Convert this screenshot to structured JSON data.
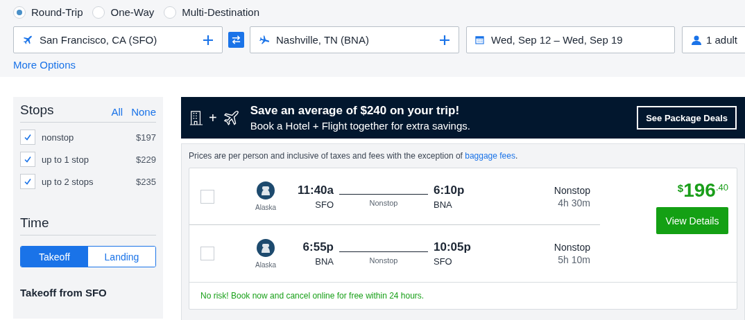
{
  "trip_types": [
    {
      "label": "Round-Trip",
      "selected": true
    },
    {
      "label": "One-Way",
      "selected": false
    },
    {
      "label": "Multi-Destination",
      "selected": false
    }
  ],
  "search": {
    "origin": "San Francisco, CA (SFO)",
    "destination": "Nashville, TN (BNA)",
    "dates": "Wed, Sep 12 – Wed, Sep 19",
    "travelers": "1 adult",
    "more_options": "More Options"
  },
  "filters": {
    "stops_title": "Stops",
    "all": "All",
    "none": "None",
    "stops": [
      {
        "label": "nonstop",
        "price": "$197",
        "checked": true
      },
      {
        "label": "up to 1 stop",
        "price": "$229",
        "checked": true
      },
      {
        "label": "up to 2 stops",
        "price": "$235",
        "checked": true
      }
    ],
    "time_title": "Time",
    "time_tabs": [
      {
        "label": "Takeoff",
        "selected": true
      },
      {
        "label": "Landing",
        "selected": false
      }
    ],
    "takeoff_heading": "Takeoff from SFO"
  },
  "banner": {
    "headline": "Save an average of $240 on your trip!",
    "subline": "Book a Hotel + Flight together for extra savings.",
    "plus": "+",
    "button": "See Package Deals"
  },
  "notice": {
    "text": "Prices are per person and inclusive of taxes and fees with the exception of ",
    "link": "baggage fees",
    "end": "."
  },
  "result": {
    "legs": [
      {
        "airline": "Alaska",
        "depart_time": "11:40a",
        "depart_airport": "SFO",
        "route_label": "Nonstop",
        "arrive_time": "6:10p",
        "arrive_airport": "BNA",
        "stops": "Nonstop",
        "duration": "4h 30m",
        "selected": false
      },
      {
        "airline": "Alaska",
        "depart_time": "6:55p",
        "depart_airport": "BNA",
        "route_label": "Nonstop",
        "arrive_time": "10:05p",
        "arrive_airport": "SFO",
        "stops": "Nonstop",
        "duration": "5h 10m",
        "selected": false
      }
    ],
    "price": {
      "currency": "$",
      "whole": "196",
      "cents": ".40"
    },
    "button": "View Details",
    "guarantee": "No risk! Book now and cancel online for free within 24 hours."
  }
}
